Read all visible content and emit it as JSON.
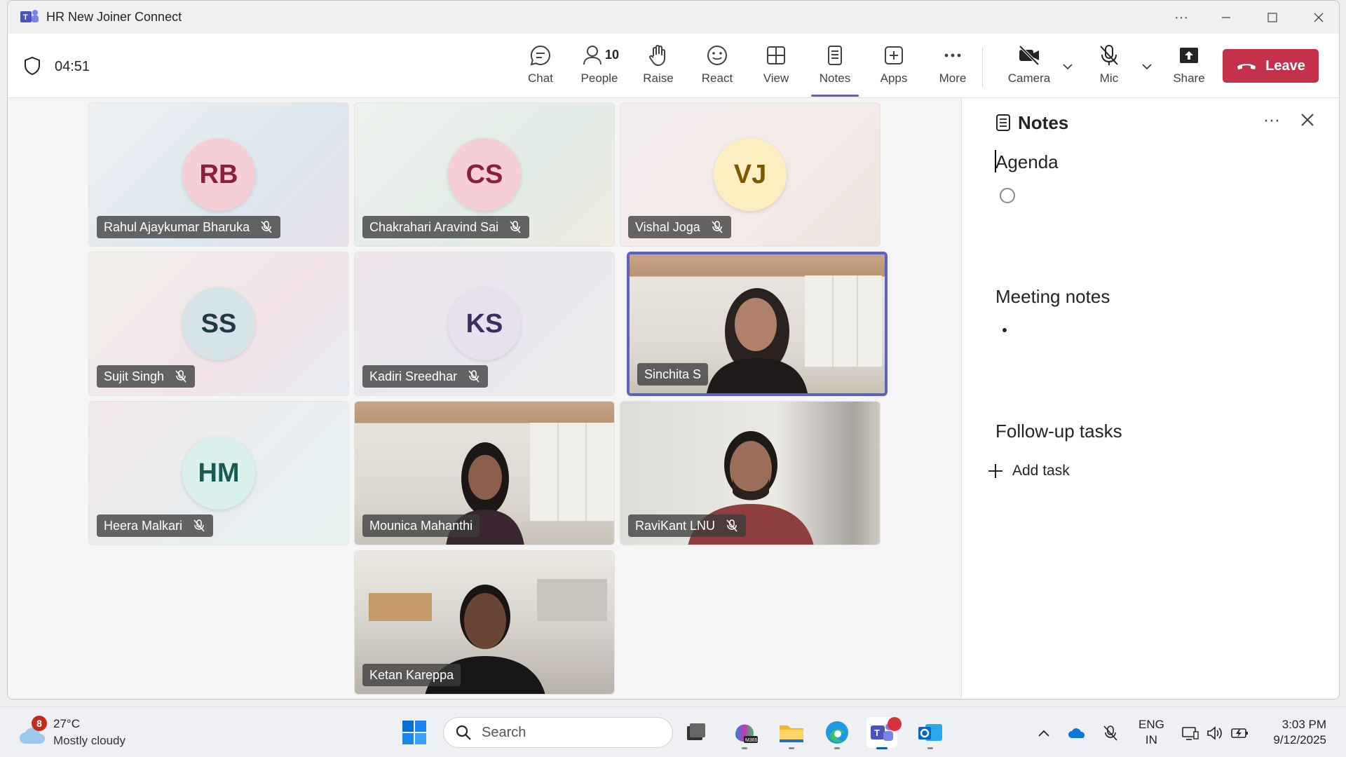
{
  "window": {
    "title": "HR New Joiner Connect"
  },
  "toolbar": {
    "timer": "04:51",
    "chat": "Chat",
    "people": "People",
    "people_count": "10",
    "raise": "Raise",
    "react": "React",
    "view": "View",
    "notes": "Notes",
    "apps": "Apps",
    "more": "More",
    "camera": "Camera",
    "mic": "Mic",
    "share": "Share",
    "leave": "Leave"
  },
  "participants": [
    {
      "initials": "RB",
      "name": "Rahul Ajaykumar Bharuka",
      "muted": true
    },
    {
      "initials": "CS",
      "name": "Chakrahari Aravind Sai",
      "muted": true
    },
    {
      "initials": "VJ",
      "name": "Vishal Joga",
      "muted": true
    },
    {
      "initials": "SS",
      "name": "Sujit Singh",
      "muted": true
    },
    {
      "initials": "KS",
      "name": "Kadiri Sreedhar",
      "muted": true
    },
    {
      "initials": "",
      "name": "Sinchita S",
      "muted": false
    },
    {
      "initials": "HM",
      "name": "Heera Malkari",
      "muted": true
    },
    {
      "initials": "",
      "name": "Mounica Mahanthi",
      "muted": false
    },
    {
      "initials": "",
      "name": "RaviKant LNU",
      "muted": true
    },
    {
      "initials": "",
      "name": "Ketan Kareppa",
      "muted": false
    }
  ],
  "notes": {
    "title": "Notes",
    "agenda": "Agenda",
    "meeting_notes": "Meeting notes",
    "follow_up": "Follow-up tasks",
    "add_task": "Add task"
  },
  "taskbar": {
    "weather_badge": "8",
    "temperature": "27°C",
    "weather": "Mostly cloudy",
    "search": "Search",
    "lang_top": "ENG",
    "lang_bottom": "IN",
    "time": "3:03 PM",
    "date": "9/12/2025"
  },
  "colors": {
    "accent": "#5b5fc7",
    "leave": "#c4314b"
  }
}
